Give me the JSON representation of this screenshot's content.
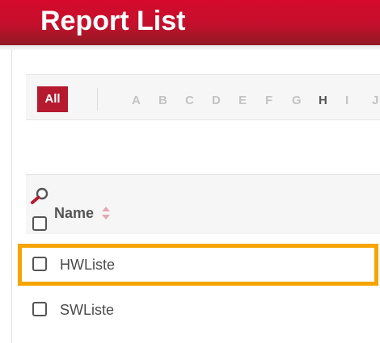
{
  "header": {
    "title": "Report List"
  },
  "alphabet": {
    "all_label": "All",
    "letters": [
      "A",
      "B",
      "C",
      "D",
      "E",
      "F",
      "G",
      "H",
      "I",
      "J"
    ],
    "active_letter": "H"
  },
  "table": {
    "columns": [
      {
        "label": "Name"
      }
    ],
    "rows": [
      {
        "name": "HWListe",
        "highlighted": true
      },
      {
        "name": "SWListe",
        "highlighted": false
      }
    ]
  },
  "colors": {
    "header_red": "#d50a2c",
    "all_button": "#b51a2e",
    "highlight": "#f5a400",
    "text": "#555555",
    "sort_icon": "#e3a9b2"
  },
  "icons": {
    "search": "magnifier-icon",
    "sort": "sort-arrows-icon"
  }
}
